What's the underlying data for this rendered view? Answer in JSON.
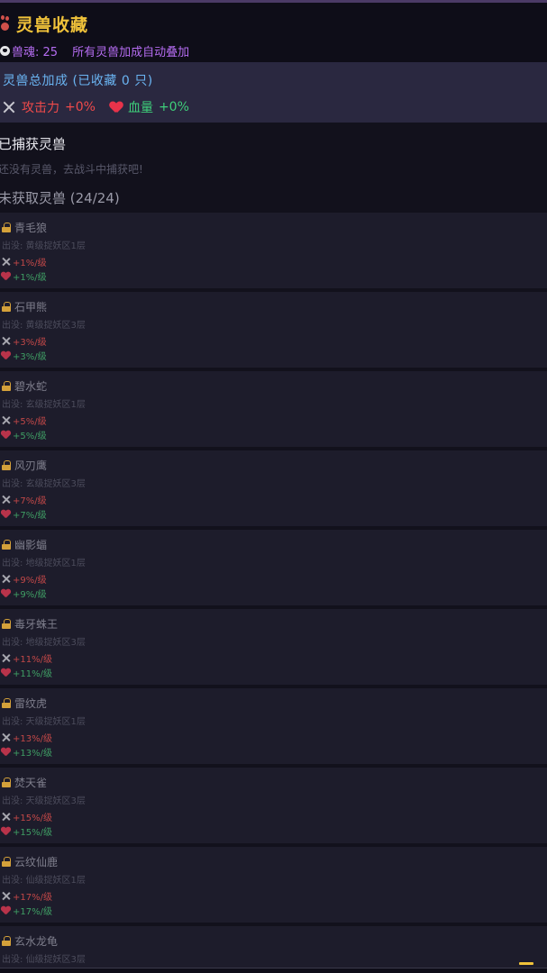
{
  "header": {
    "title": "灵兽收藏",
    "soul_label": "兽魂: 25",
    "auto_note": "所有灵兽加成自动叠加",
    "paw_icon": "paw-icon",
    "soul_icon": "soul-icon"
  },
  "bonus": {
    "title": "灵兽总加成 (已收藏 0 只)",
    "attack_label": "攻击力",
    "attack_value": "+0%",
    "hp_label": "血量",
    "hp_value": "+0%"
  },
  "caught": {
    "title": "已捕获灵兽",
    "empty_text": "还没有灵兽，去战斗中捕获吧!"
  },
  "uncaught": {
    "title": "未获取灵兽 (24/24)",
    "items": [
      {
        "name": "青毛狼",
        "location": "出没: 黄级捉妖区1层",
        "atk": "+1%/级",
        "hp": "+1%/级"
      },
      {
        "name": "石甲熊",
        "location": "出没: 黄级捉妖区3层",
        "atk": "+3%/级",
        "hp": "+3%/级"
      },
      {
        "name": "碧水蛇",
        "location": "出没: 玄级捉妖区1层",
        "atk": "+5%/级",
        "hp": "+5%/级"
      },
      {
        "name": "风刃鹰",
        "location": "出没: 玄级捉妖区3层",
        "atk": "+7%/级",
        "hp": "+7%/级"
      },
      {
        "name": "幽影蝠",
        "location": "出没: 地级捉妖区1层",
        "atk": "+9%/级",
        "hp": "+9%/级"
      },
      {
        "name": "毒牙蛛王",
        "location": "出没: 地级捉妖区3层",
        "atk": "+11%/级",
        "hp": "+11%/级"
      },
      {
        "name": "雷纹虎",
        "location": "出没: 天级捉妖区1层",
        "atk": "+13%/级",
        "hp": "+13%/级"
      },
      {
        "name": "焚天雀",
        "location": "出没: 天级捉妖区3层",
        "atk": "+15%/级",
        "hp": "+15%/级"
      },
      {
        "name": "云纹仙鹿",
        "location": "出没: 仙级捉妖区1层",
        "atk": "+17%/级",
        "hp": "+17%/级"
      },
      {
        "name": "玄水龙龟",
        "location": "出没: 仙级捉妖区3层",
        "atk": "",
        "hp": ""
      }
    ]
  },
  "colors": {
    "title_gold": "#f0c23a",
    "soul_purple": "#b46cf0",
    "bonus_blue": "#6ab4f2",
    "attack_red": "#f04a4a",
    "hp_green": "#3ecf7a",
    "lock_gold": "#d4a13a",
    "card_bg": "#1d1c2b",
    "page_bg": "#12111c"
  }
}
